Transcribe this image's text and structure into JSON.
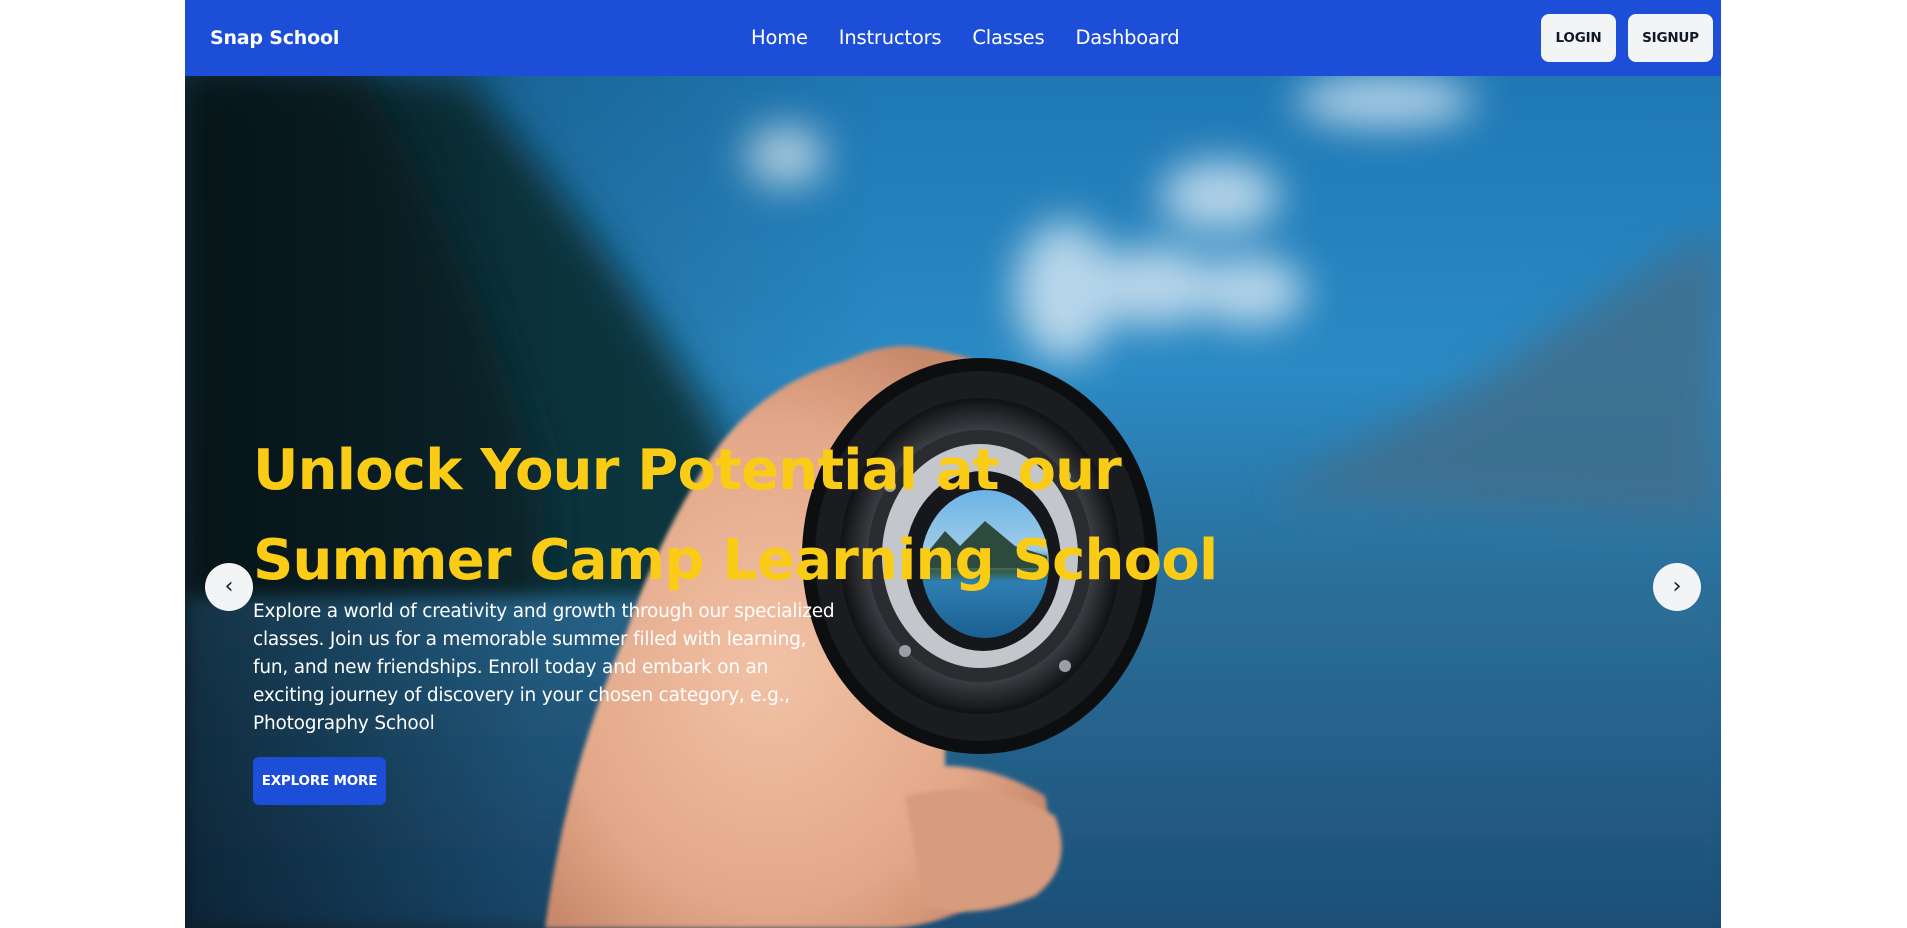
{
  "navbar": {
    "brand": "Snap School",
    "links": [
      "Home",
      "Instructors",
      "Classes",
      "Dashboard"
    ],
    "login_label": "LOGIN",
    "signup_label": "SIGNUP",
    "bg_color": "#1d4ed8"
  },
  "hero": {
    "title": "Unlock Your Potential at our Summer Camp Learning School",
    "description": "Explore a world of creativity and growth through our specialized classes. Join us for a memorable summer filled with learning, fun, and new friendships. Enroll today and embark on an exciting journey of discovery in your chosen category, e.g., Photography School",
    "cta_label": "EXPLORE MORE",
    "prev_icon": "‹",
    "next_icon": "›",
    "title_color": "#facc15",
    "image": "hand-holding-camera-lens-lake-photo"
  }
}
